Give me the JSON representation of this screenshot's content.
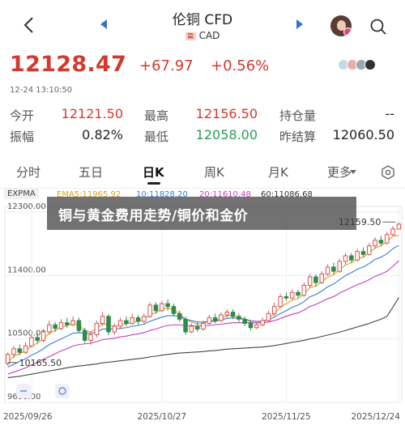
{
  "header": {
    "title": "伦铜 CFD",
    "currency_flag": "篇",
    "currency": "CAD"
  },
  "quote": {
    "price": "12128.47",
    "change": "+67.97",
    "change_pct": "+0.56%",
    "timestamp": "12-24 13:10:50"
  },
  "stats": [
    {
      "label": "今开",
      "value": "12121.50",
      "tone": "red"
    },
    {
      "label": "最高",
      "value": "12156.50",
      "tone": "red"
    },
    {
      "label": "持仓量",
      "value": "--",
      "tone": "dark"
    },
    {
      "label": "振幅",
      "value": "0.82%",
      "tone": "dark"
    },
    {
      "label": "最低",
      "value": "12058.00",
      "tone": "green"
    },
    {
      "label": "昨结算",
      "value": "12060.50",
      "tone": "dark"
    }
  ],
  "tabs": [
    {
      "label": "分时",
      "active": false
    },
    {
      "label": "五日",
      "active": false
    },
    {
      "label": "日K",
      "active": true
    },
    {
      "label": "周K",
      "active": false
    },
    {
      "label": "月K",
      "active": false
    },
    {
      "label": "更多",
      "active": false
    }
  ],
  "indicator": {
    "name": "EXPMA",
    "items": [
      {
        "label": "EMA5:11965.92",
        "color": "#e0a020"
      },
      {
        "label": "10:11828.20",
        "color": "#3a7bd5"
      },
      {
        "label": "20:11610.48",
        "color": "#c040c0"
      },
      {
        "label": "60:11086.68",
        "color": "#333333"
      }
    ]
  },
  "banner": "铜与黄金费用走势/铜价和金价",
  "chart_data": {
    "type": "candlestick",
    "y_ticks": [
      "12300.00",
      "11400.00",
      "10500.00",
      "9600.00"
    ],
    "x_ticks": [
      "2025/09/26",
      "2025/10/27",
      "2025/11/25",
      "2025/12/24"
    ],
    "ylim": [
      9600,
      12300
    ],
    "annotations": {
      "high": "12159.50",
      "low": "10165.50"
    },
    "candles": [
      [
        10150,
        10280,
        10120,
        10310
      ],
      [
        10280,
        10360,
        10230,
        10400
      ],
      [
        10360,
        10310,
        10270,
        10420
      ],
      [
        10310,
        10400,
        10290,
        10450
      ],
      [
        10400,
        10520,
        10380,
        10560
      ],
      [
        10520,
        10480,
        10440,
        10580
      ],
      [
        10480,
        10600,
        10450,
        10640
      ],
      [
        10600,
        10700,
        10560,
        10760
      ],
      [
        10700,
        10650,
        10600,
        10740
      ],
      [
        10650,
        10730,
        10620,
        10780
      ],
      [
        10730,
        10700,
        10660,
        10800
      ],
      [
        10700,
        10760,
        10680,
        10820
      ],
      [
        10760,
        10620,
        10580,
        10800
      ],
      [
        10620,
        10480,
        10440,
        10660
      ],
      [
        10480,
        10560,
        10420,
        10600
      ],
      [
        10560,
        10720,
        10520,
        10760
      ],
      [
        10720,
        10820,
        10680,
        10880
      ],
      [
        10820,
        10600,
        10550,
        10850
      ],
      [
        10600,
        10680,
        10560,
        10720
      ],
      [
        10680,
        10760,
        10640,
        10800
      ],
      [
        10760,
        10720,
        10680,
        10820
      ],
      [
        10720,
        10800,
        10700,
        10860
      ],
      [
        10800,
        10750,
        10700,
        10840
      ],
      [
        10750,
        10820,
        10720,
        10860
      ],
      [
        10820,
        10980,
        10800,
        11020
      ],
      [
        10980,
        10900,
        10860,
        11020
      ],
      [
        10900,
        11000,
        10880,
        11040
      ],
      [
        11000,
        10960,
        10900,
        11060
      ],
      [
        10960,
        10860,
        10820,
        11000
      ],
      [
        10860,
        10780,
        10740,
        10900
      ],
      [
        10780,
        10600,
        10560,
        10820
      ],
      [
        10600,
        10680,
        10580,
        10720
      ],
      [
        10680,
        10640,
        10600,
        10740
      ],
      [
        10640,
        10720,
        10620,
        10760
      ],
      [
        10720,
        10800,
        10700,
        10840
      ],
      [
        10800,
        10760,
        10720,
        10860
      ],
      [
        10760,
        10840,
        10740,
        10880
      ],
      [
        10840,
        10880,
        10800,
        10920
      ],
      [
        10880,
        10820,
        10780,
        10920
      ],
      [
        10820,
        10780,
        10740,
        10860
      ],
      [
        10780,
        10720,
        10680,
        10820
      ],
      [
        10720,
        10660,
        10620,
        10760
      ],
      [
        10660,
        10700,
        10640,
        10740
      ],
      [
        10700,
        10760,
        10680,
        10800
      ],
      [
        10760,
        10860,
        10740,
        10900
      ],
      [
        10860,
        10960,
        10820,
        11020
      ],
      [
        10960,
        11100,
        10940,
        11140
      ],
      [
        11100,
        11080,
        11040,
        11160
      ],
      [
        11080,
        11160,
        11060,
        11200
      ],
      [
        11160,
        11120,
        11080,
        11200
      ],
      [
        11120,
        11260,
        11100,
        11300
      ],
      [
        11260,
        11380,
        11220,
        11420
      ],
      [
        11380,
        11300,
        11240,
        11420
      ],
      [
        11300,
        11420,
        11280,
        11460
      ],
      [
        11420,
        11520,
        11400,
        11560
      ],
      [
        11520,
        11460,
        11420,
        11580
      ],
      [
        11460,
        11600,
        11440,
        11640
      ],
      [
        11600,
        11680,
        11560,
        11720
      ],
      [
        11680,
        11620,
        11580,
        11720
      ],
      [
        11620,
        11740,
        11600,
        11780
      ],
      [
        11740,
        11700,
        11660,
        11800
      ],
      [
        11700,
        11820,
        11680,
        11860
      ],
      [
        11820,
        11900,
        11780,
        11940
      ],
      [
        11900,
        11860,
        11820,
        11960
      ],
      [
        11860,
        11980,
        11840,
        12020
      ],
      [
        11980,
        12060,
        11960,
        12100
      ],
      [
        12060,
        12128,
        12058,
        12156
      ]
    ],
    "ema": [
      {
        "name": "EMA5",
        "color": "#e0a020",
        "values": [
          10180,
          10250,
          10290,
          10330,
          10400,
          10440,
          10500,
          10580,
          10620,
          10660,
          10690,
          10720,
          10690,
          10620,
          10600,
          10650,
          10720,
          10690,
          10680,
          10700,
          10710,
          10740,
          10750,
          10770,
          10850,
          10870,
          10920,
          10940,
          10910,
          10860,
          10770,
          10740,
          10710,
          10720,
          10760,
          10760,
          10790,
          10830,
          10830,
          10810,
          10780,
          10740,
          10730,
          10740,
          10790,
          10860,
          10950,
          11000,
          11050,
          11070,
          11140,
          11230,
          11250,
          11310,
          11380,
          11410,
          11480,
          11550,
          11580,
          11640,
          11660,
          11720,
          11790,
          11820,
          11880,
          11960,
          11966
        ]
      },
      {
        "name": "EMA10",
        "color": "#3a7bd5",
        "values": [
          10100,
          10140,
          10180,
          10220,
          10270,
          10310,
          10360,
          10420,
          10460,
          10500,
          10540,
          10580,
          10590,
          10580,
          10580,
          10600,
          10640,
          10640,
          10640,
          10650,
          10660,
          10680,
          10690,
          10710,
          10750,
          10780,
          10810,
          10830,
          10830,
          10820,
          10780,
          10760,
          10740,
          10740,
          10750,
          10750,
          10770,
          10790,
          10800,
          10790,
          10780,
          10760,
          10750,
          10750,
          10770,
          10810,
          10860,
          10900,
          10950,
          10980,
          11030,
          11100,
          11130,
          11180,
          11240,
          11280,
          11340,
          11400,
          11440,
          11490,
          11520,
          11570,
          11630,
          11660,
          11710,
          11780,
          11828
        ]
      },
      {
        "name": "EMA20",
        "color": "#c040c0",
        "values": [
          10000,
          10030,
          10060,
          10090,
          10130,
          10170,
          10210,
          10250,
          10290,
          10330,
          10360,
          10400,
          10420,
          10430,
          10440,
          10460,
          10490,
          10500,
          10510,
          10530,
          10540,
          10560,
          10570,
          10590,
          10620,
          10640,
          10670,
          10690,
          10700,
          10700,
          10690,
          10690,
          10680,
          10690,
          10690,
          10700,
          10710,
          10720,
          10730,
          10730,
          10730,
          10730,
          10730,
          10730,
          10740,
          10760,
          10790,
          10820,
          10850,
          10870,
          10910,
          10960,
          10990,
          11030,
          11070,
          11100,
          11150,
          11190,
          11230,
          11270,
          11300,
          11340,
          11390,
          11420,
          11460,
          11530,
          11610
        ]
      },
      {
        "name": "EMA60",
        "color": "#444444",
        "values": [
          9950,
          9960,
          9970,
          9985,
          10000,
          10015,
          10030,
          10045,
          10060,
          10075,
          10090,
          10105,
          10115,
          10125,
          10135,
          10145,
          10160,
          10170,
          10180,
          10190,
          10200,
          10210,
          10220,
          10230,
          10245,
          10255,
          10270,
          10280,
          10290,
          10300,
          10305,
          10310,
          10315,
          10320,
          10330,
          10335,
          10345,
          10355,
          10360,
          10365,
          10370,
          10375,
          10380,
          10385,
          10395,
          10405,
          10420,
          10435,
          10450,
          10465,
          10480,
          10500,
          10515,
          10535,
          10555,
          10575,
          10595,
          10620,
          10645,
          10670,
          10695,
          10720,
          10750,
          10780,
          10820,
          10950,
          11087
        ]
      }
    ]
  }
}
